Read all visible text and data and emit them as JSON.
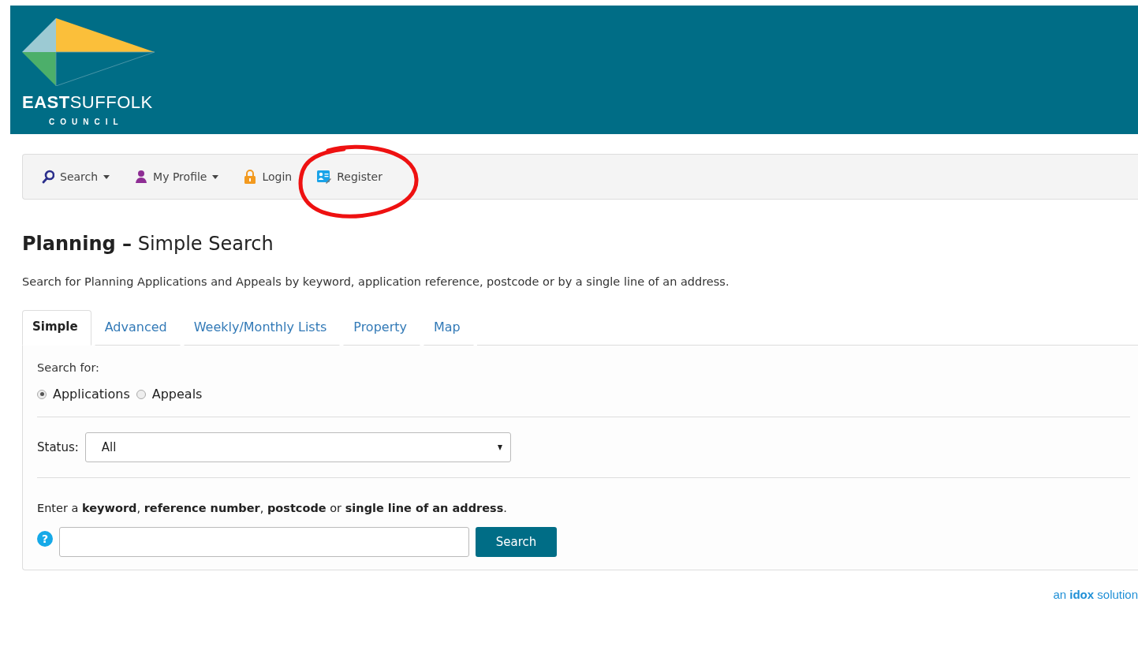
{
  "header": {
    "logo": {
      "name": "**EAST**SUFFOLK",
      "subtitle": "COUNCIL"
    }
  },
  "nav": [
    {
      "kind": "search",
      "label": "Search",
      "dropdown": true
    },
    {
      "kind": "profile",
      "label": "My Profile",
      "dropdown": true
    },
    {
      "kind": "login",
      "label": "Login",
      "dropdown": false
    },
    {
      "kind": "register",
      "label": "Register",
      "dropdown": false,
      "circled": true
    }
  ],
  "page": {
    "title_bold": "Planning –",
    "title": "Simple Search",
    "description": "Search for Planning Applications and Appeals by keyword, application reference, postcode or by a single line of an address."
  },
  "tabs": [
    {
      "label": "Simple",
      "selected": true
    },
    {
      "label": "Advanced",
      "selected": false
    },
    {
      "label": "Weekly/Monthly Lists",
      "selected": false
    },
    {
      "label": "Property",
      "selected": false
    },
    {
      "label": "Map",
      "selected": false
    }
  ],
  "form": {
    "search_for_label": "Search for:",
    "radios": [
      {
        "label": "Applications",
        "selected": true
      },
      {
        "label": "Appeals",
        "selected": false
      }
    ],
    "status_label": "Status:",
    "status_value": "All",
    "instructions": "Enter a **keyword**, **reference number**, **postcode** or **single line of an address**.",
    "help_icon": "?",
    "search_button": "Search"
  },
  "footer": {
    "brand": "an **idox** solution"
  }
}
